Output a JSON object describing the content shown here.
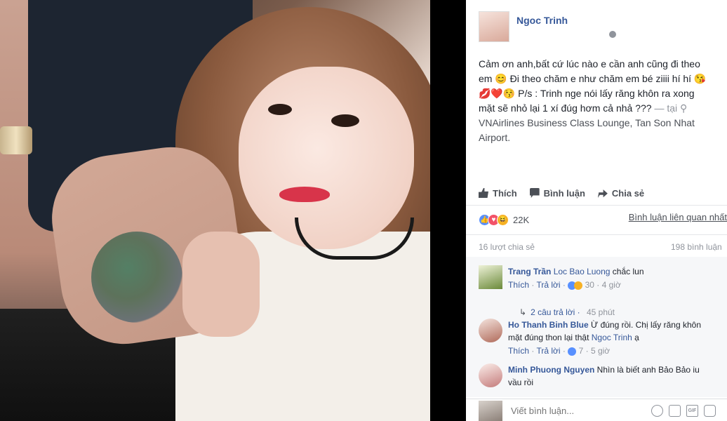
{
  "post": {
    "author": "Ngoc Trinh",
    "text_line_1": "Cảm ơn anh,bất cứ lúc nào e cần anh cũng đi theo",
    "text_line_2": "em 😊 Đi theo chăm e như chăm em bé ziiii hí hí 😘",
    "text_line_3": "💋❤️😚 P/s : Trinh nge nói lấy răng khôn ra xong",
    "text_line_4": "mặt sẽ nhỏ lại 1 xí đúg hơm cả nhả ???",
    "location_prefix": "— tại",
    "location_name": "VNAirlines Business Class Lounge, Tan Son Nhat Airport."
  },
  "actions": {
    "like": "Thích",
    "comment": "Bình luận",
    "share": "Chia sẻ"
  },
  "reactions": {
    "count": "22K",
    "related_comments": "Bình luận liên quan nhất"
  },
  "stats": {
    "shares": "16 lượt chia sẻ",
    "comments": "198 bình luận"
  },
  "comments": [
    {
      "name": "Trang Trần",
      "tag": "Loc Bao Luong",
      "text": "chắc lun",
      "like": "Thích",
      "reply": "Trả lời",
      "reactions": "30",
      "time": "4 giờ",
      "replies": "2 câu trả lời",
      "replies_time": "45 phút"
    },
    {
      "name": "Ho Thanh Binh Blue",
      "text_line_1": "Ừ đúng rồi. Chị lấy răng khôn",
      "text_line_2": "mặt đúng thon lại thật",
      "tag": "Ngoc Trinh",
      "text_tail": "ạ",
      "like": "Thích",
      "reply": "Trả lời",
      "reactions": "7",
      "time": "5 giờ"
    },
    {
      "name": "Minh Phuong Nguyen",
      "text_line_1": "Nhìn là biết anh Bảo Bảo iu",
      "text_line_2": "vầu rồi"
    }
  ],
  "compose": {
    "placeholder": "Viết bình luận..."
  },
  "icons": [
    "globe-icon",
    "like-icon",
    "comment-icon",
    "share-icon",
    "emoji-icon",
    "camera-icon",
    "gif-icon",
    "sticker-icon"
  ],
  "colors": {
    "link": "#365899",
    "muted": "#90949c",
    "like_blue": "#5890ff",
    "love_red": "#f25268",
    "haha_yellow": "#f7b125"
  }
}
